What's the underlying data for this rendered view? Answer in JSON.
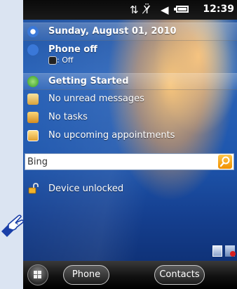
{
  "status": {
    "time": "12:39"
  },
  "today": {
    "date": "Sunday, August 01, 2010",
    "phone_status": "Phone off",
    "phone_sub": ": Off",
    "getting_started": "Getting Started",
    "messages": "No unread messages",
    "tasks": "No tasks",
    "appointments": "No upcoming appointments",
    "device_lock": "Device unlocked"
  },
  "search": {
    "value": "Bing"
  },
  "taskbar": {
    "phone_label": "Phone",
    "contacts_label": "Contacts"
  },
  "colors": {
    "accent": "#f09000",
    "screen_blue": "#1e56ad"
  }
}
